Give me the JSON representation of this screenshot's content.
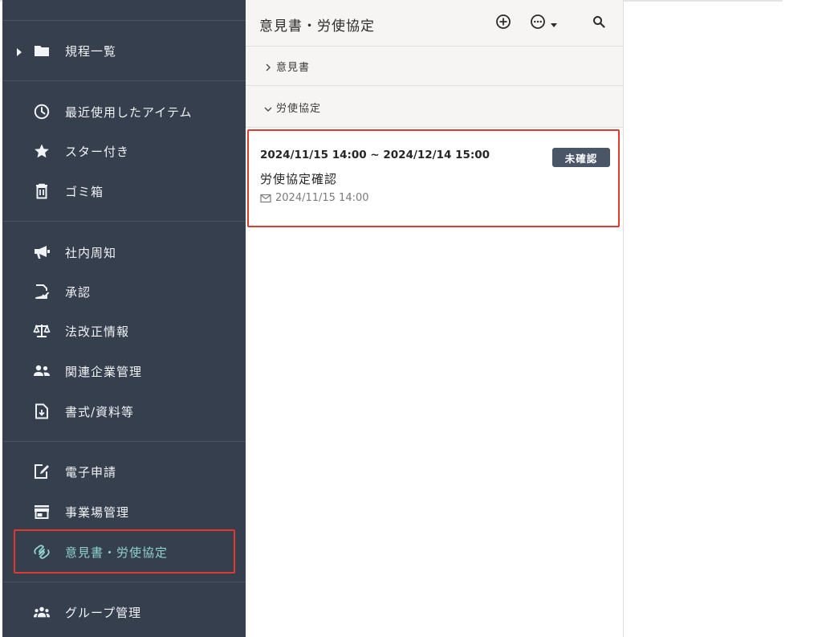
{
  "sidebar": {
    "folder_item": {
      "label": "規程一覧",
      "icon": "folder-icon"
    },
    "groups": [
      [
        {
          "label": "最近使用したアイテム",
          "icon": "clock-icon"
        },
        {
          "label": "スター付き",
          "icon": "star-icon"
        },
        {
          "label": "ゴミ箱",
          "icon": "trash-icon"
        }
      ],
      [
        {
          "label": "社内周知",
          "icon": "megaphone-icon"
        },
        {
          "label": "承認",
          "icon": "approval-document-icon"
        },
        {
          "label": "法改正情報",
          "icon": "scale-icon"
        },
        {
          "label": "関連企業管理",
          "icon": "people-icon"
        },
        {
          "label": "書式/資料等",
          "icon": "download-document-icon"
        }
      ],
      [
        {
          "label": "電子申請",
          "icon": "edit-document-icon"
        },
        {
          "label": "事業場管理",
          "icon": "store-icon"
        },
        {
          "label": "意見書・労使協定",
          "icon": "handshake-icon",
          "active": true
        }
      ],
      [
        {
          "label": "グループ管理",
          "icon": "group-icon"
        }
      ]
    ],
    "active_color": "#8fd3cf",
    "background": "#353f4e"
  },
  "panel": {
    "title": "意見書・労使協定",
    "header_icons": [
      "add-circle-icon",
      "more-options-icon",
      "search-icon"
    ],
    "sections": [
      {
        "label": "意見書",
        "expanded": false
      },
      {
        "label": "労使協定",
        "expanded": true
      }
    ],
    "card": {
      "range": "2024/11/15 14:00 ~ 2024/12/14 15:00",
      "badge": "未確認",
      "title": "労使協定確認",
      "date": "2024/11/15 14:00"
    }
  },
  "colors": {
    "highlight": "#e03a2f",
    "badge": "#4a5567"
  }
}
